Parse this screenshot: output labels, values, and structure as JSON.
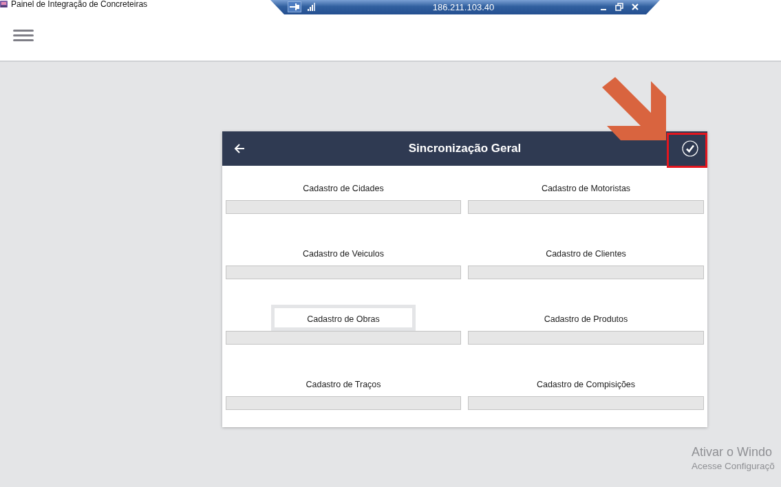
{
  "window": {
    "title": "Painel de Integração de Concreteiras"
  },
  "remote_bar": {
    "address": "186.211.103.40",
    "pinned": true
  },
  "dialog": {
    "title": "Sincronização Geral",
    "items": [
      {
        "label": "Cadastro de Cidades",
        "level": 0,
        "focused": false
      },
      {
        "label": "Cadastro de Motoristas",
        "level": 0,
        "focused": false
      },
      {
        "label": "Cadastro de Veiculos",
        "level": 0,
        "focused": false
      },
      {
        "label": "Cadastro de Clientes",
        "level": 0,
        "focused": false
      },
      {
        "label": "Cadastro de Obras",
        "level": 0,
        "focused": true
      },
      {
        "label": "Cadastro de Produtos",
        "level": 0,
        "focused": false
      },
      {
        "label": "Cadastro de Traços",
        "level": 0,
        "focused": false
      },
      {
        "label": "Cadastro de Compisições",
        "level": 0,
        "focused": false
      }
    ]
  },
  "activation_notice": {
    "title": "Ativar o Windo",
    "subtitle": "Acesse Configuraçõ"
  }
}
